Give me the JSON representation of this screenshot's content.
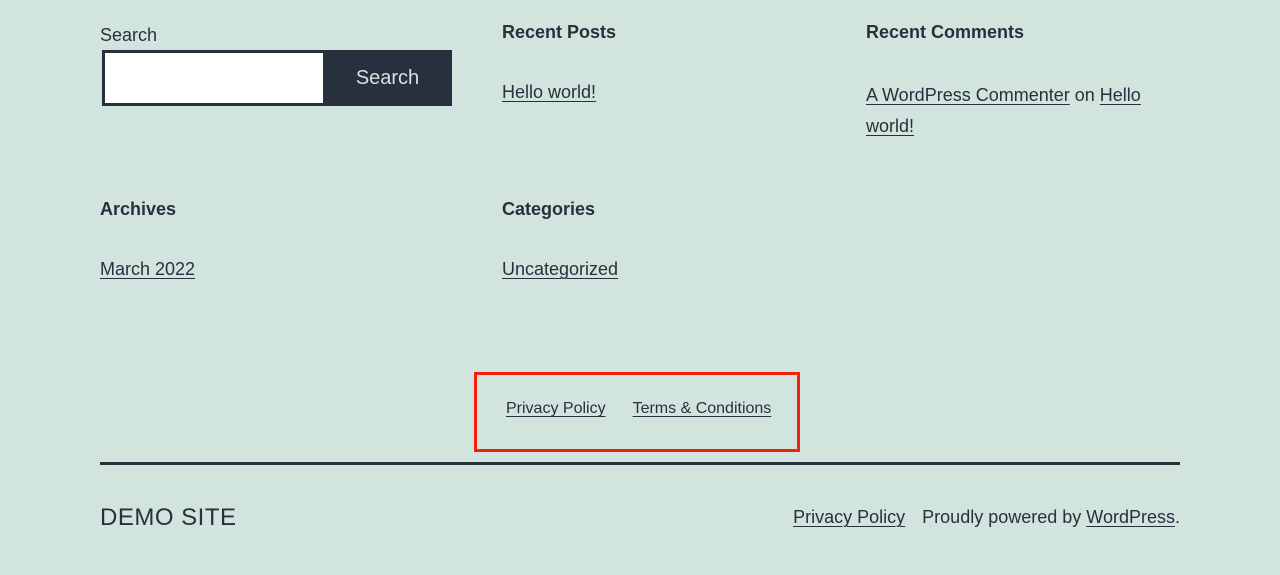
{
  "search": {
    "label": "Search",
    "input_value": "",
    "input_placeholder": "",
    "button_label": "Search"
  },
  "recent_posts": {
    "title": "Recent Posts",
    "items": [
      {
        "label": "Hello world!"
      }
    ]
  },
  "recent_comments": {
    "title": "Recent Comments",
    "author": "A WordPress Commenter",
    "connector": "on",
    "post_line1": "Hello",
    "post_line2": "world!"
  },
  "archives": {
    "title": "Archives",
    "items": [
      {
        "label": "March 2022"
      }
    ]
  },
  "categories": {
    "title": "Categories",
    "items": [
      {
        "label": "Uncategorized"
      }
    ]
  },
  "footer_nav": {
    "items": [
      {
        "label": "Privacy Policy"
      },
      {
        "label": "Terms & Conditions"
      }
    ],
    "highlight_color": "#f5200a"
  },
  "site_footer": {
    "site_title": "DEMO SITE",
    "privacy_label": "Privacy Policy",
    "powered_prefix": "Proudly powered by",
    "powered_link": "WordPress",
    "powered_suffix": "."
  },
  "colors": {
    "background": "#d1e4dd",
    "text": "#28303d"
  }
}
